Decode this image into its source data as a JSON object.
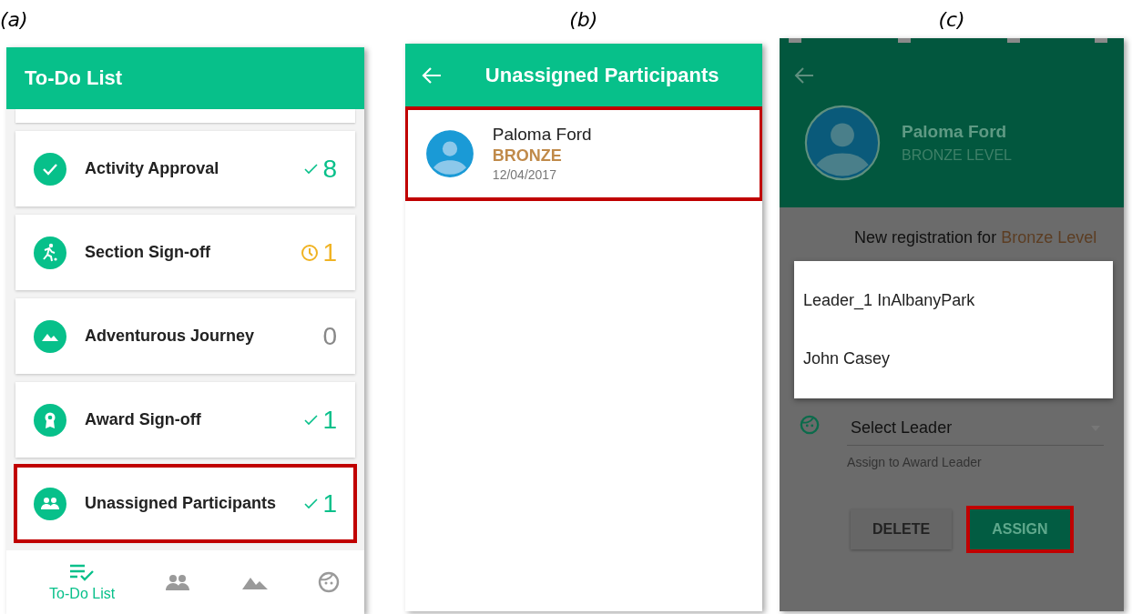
{
  "panels": [
    {
      "caption": "(a)",
      "title": "To-Do List",
      "items": [
        {
          "label": "Activity Approval",
          "count": "8",
          "kind": "done",
          "highlighted": false
        },
        {
          "label": "Section Sign-off",
          "count": "1",
          "kind": "pending",
          "highlighted": false
        },
        {
          "label": "Adventurous Journey",
          "count": "0",
          "kind": "none",
          "highlighted": false
        },
        {
          "label": "Award Sign-off",
          "count": "1",
          "kind": "done",
          "highlighted": false
        },
        {
          "label": "Unassigned Participants",
          "count": "1",
          "kind": "done",
          "highlighted": true
        }
      ],
      "bottom_nav": [
        {
          "label": "To-Do List",
          "selected": true
        },
        {
          "selected": false
        },
        {
          "selected": false
        },
        {
          "selected": false
        }
      ]
    },
    {
      "caption": "(b)",
      "title": "Unassigned Participants",
      "participants": [
        {
          "name": "Paloma Ford",
          "level": "BRONZE",
          "date": "12/04/2017",
          "highlighted": true
        }
      ]
    },
    {
      "caption": "(c)",
      "name": "Paloma Ford",
      "level": "BRONZE LEVEL",
      "registration": {
        "text": "New registration for",
        "level": "Bronze Level"
      },
      "leader_field": {
        "placeholder": "Select Leader",
        "helper": "Assign to Award Leader"
      },
      "menu": [
        "Leader_1 InAlbanyPark",
        "John Casey"
      ],
      "buttons": [
        {
          "label": "DELETE",
          "kind": "flat",
          "highlighted": false
        },
        {
          "label": "ASSIGN",
          "kind": "primary",
          "highlighted": true
        }
      ]
    }
  ]
}
